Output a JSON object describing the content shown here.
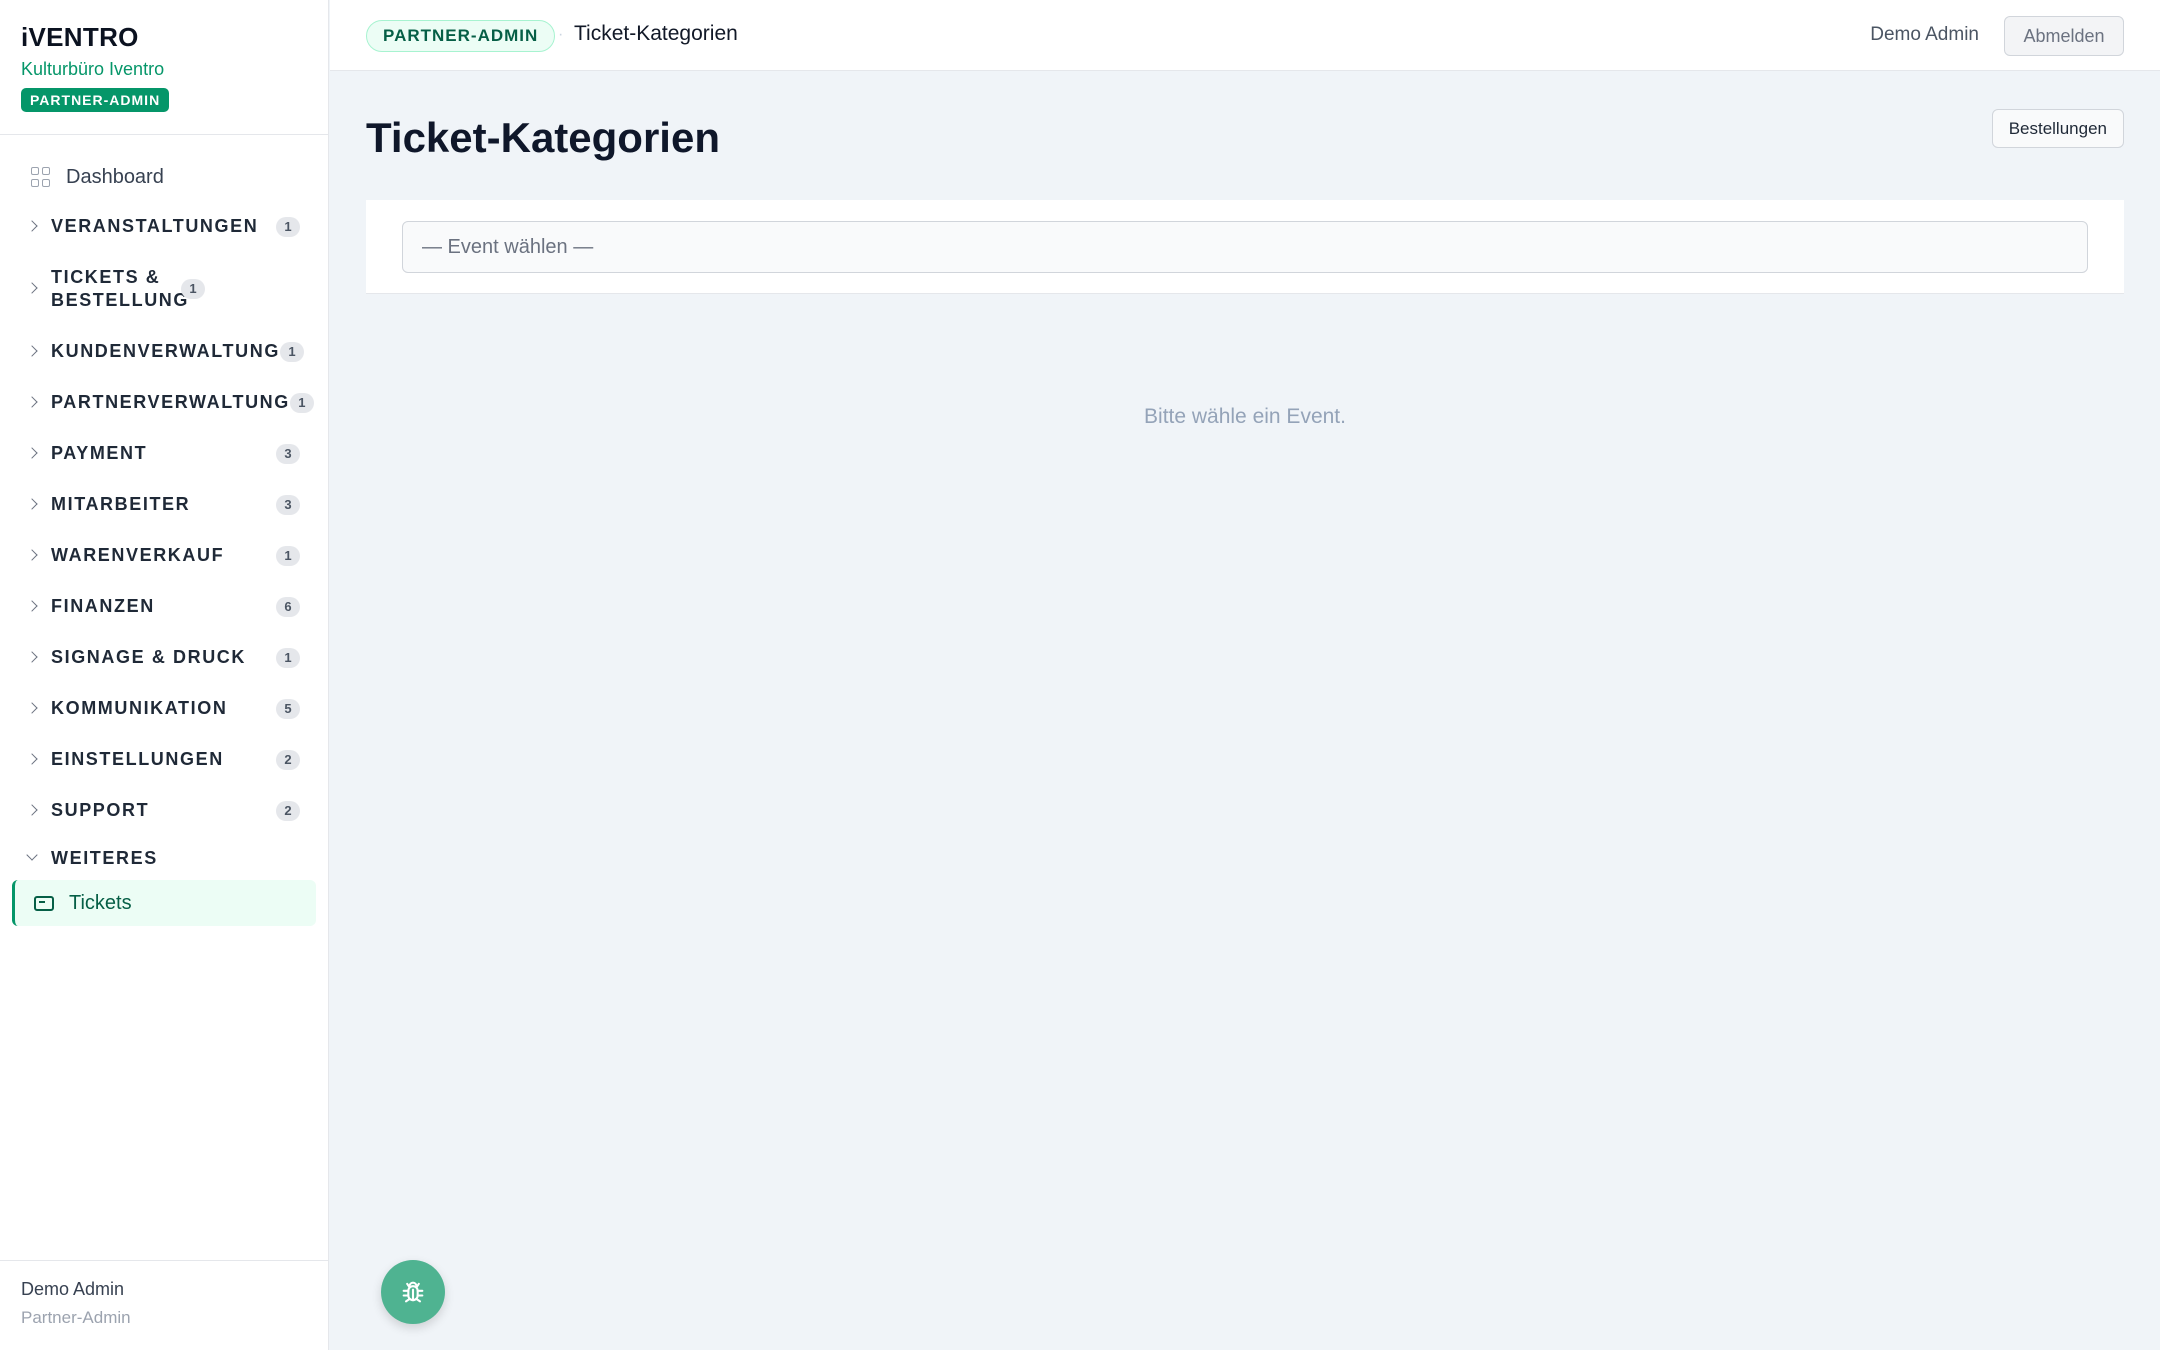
{
  "brand": {
    "logo": "iVENTRO",
    "org": "Kulturbüro Iventro",
    "badge": "PARTNER-ADMIN"
  },
  "sidebar": {
    "dashboard_label": "Dashboard",
    "groups": [
      {
        "label": "VERANSTALTUNGEN",
        "count": "1"
      },
      {
        "label": "TICKETS & BESTELLUNG",
        "count": "1"
      },
      {
        "label": "KUNDENVERWALTUNG",
        "count": "1"
      },
      {
        "label": "PARTNERVERWALTUNG",
        "count": "1"
      },
      {
        "label": "PAYMENT",
        "count": "3"
      },
      {
        "label": "MITARBEITER",
        "count": "3"
      },
      {
        "label": "WARENVERKAUF",
        "count": "1"
      },
      {
        "label": "FINANZEN",
        "count": "6"
      },
      {
        "label": "SIGNAGE & DRUCK",
        "count": "1"
      },
      {
        "label": "KOMMUNIKATION",
        "count": "5"
      },
      {
        "label": "EINSTELLUNGEN",
        "count": "2"
      },
      {
        "label": "SUPPORT",
        "count": "2"
      }
    ],
    "open_group": "WEITERES",
    "active_item": "Tickets",
    "footer": {
      "name": "Demo Admin",
      "role": "Partner-Admin"
    }
  },
  "topbar": {
    "badge": "PARTNER-ADMIN",
    "separator": "·",
    "title": "Ticket-Kategorien",
    "user": "Demo Admin",
    "logout": "Abmelden"
  },
  "main": {
    "title": "Ticket-Kategorien",
    "orders_button": "Bestellungen",
    "event_select": "— Event wählen —",
    "empty_message": "Bitte wähle ein Event."
  },
  "fab": {
    "icon": "bug-icon"
  },
  "colors": {
    "accent": "#059669",
    "accent_light": "#ecfdf5",
    "fab": "#4fb391",
    "background": "#f0f4f8"
  }
}
